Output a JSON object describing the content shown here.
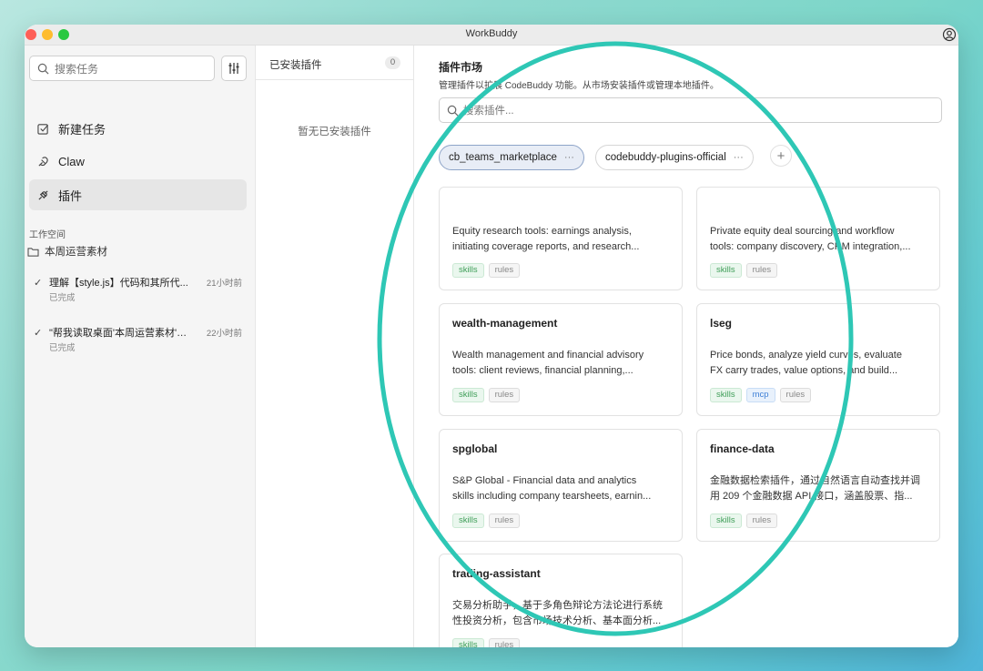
{
  "window": {
    "title": "WorkBuddy"
  },
  "sidebar": {
    "search_placeholder": "搜索任务",
    "items": [
      {
        "label": "新建任务",
        "icon": "edit-icon"
      },
      {
        "label": "Claw",
        "icon": "claw-icon"
      },
      {
        "label": "插件",
        "icon": "plugin-icon",
        "active": true
      }
    ],
    "workspace_label": "工作空间",
    "folder": "本周运营素材",
    "tasks": [
      {
        "title": "理解【style.js】代码和其所代...",
        "time": "21小时前",
        "status": "已完成"
      },
      {
        "title": "\"帮我读取桌面'本周运营素材'文...",
        "time": "22小时前",
        "status": "已完成"
      }
    ]
  },
  "installed": {
    "label": "已安装插件",
    "count": "0",
    "empty": "暂无已安装插件"
  },
  "market": {
    "title": "插件市场",
    "description": "管理插件以扩展 CodeBuddy 功能。从市场安装插件或管理本地插件。",
    "search_placeholder": "搜索插件...",
    "tabs": [
      {
        "label": "cb_teams_marketplace",
        "active": true
      },
      {
        "label": "codebuddy-plugins-official",
        "active": false
      }
    ],
    "more_glyph": "···",
    "add_glyph": "+",
    "cards": [
      {
        "name": "",
        "desc1": "Equity research tools: earnings analysis,",
        "desc2": "initiating coverage reports, and research...",
        "tags": [
          "skills",
          "rules"
        ]
      },
      {
        "name": "",
        "desc1": "Private equity deal sourcing and workflow",
        "desc2": "tools: company discovery, CRM integration,...",
        "tags": [
          "skills",
          "rules"
        ]
      },
      {
        "name": "wealth-management",
        "desc1": "Wealth management and financial advisory",
        "desc2": "tools: client reviews, financial planning,...",
        "tags": [
          "skills",
          "rules"
        ]
      },
      {
        "name": "lseg",
        "desc1": "Price bonds, analyze yield curves, evaluate",
        "desc2": "FX carry trades, value options, and build...",
        "tags": [
          "skills",
          "mcp",
          "rules"
        ]
      },
      {
        "name": "spglobal",
        "desc1": "S&P Global - Financial data and analytics",
        "desc2": "skills including company tearsheets, earnin...",
        "tags": [
          "skills",
          "rules"
        ]
      },
      {
        "name": "finance-data",
        "desc1": "金融数据检索插件，通过自然语言自动查找并调",
        "desc2": "用 209 个金融数据 API 接口，涵盖股票、指...",
        "tags": [
          "skills",
          "rules"
        ]
      },
      {
        "name": "trading-assistant",
        "desc1": "交易分析助手，基于多角色辩论方法论进行系统",
        "desc2": "性投资分析，包含市场技术分析、基本面分析...",
        "tags": [
          "skills",
          "rules"
        ]
      }
    ]
  },
  "annotation": {
    "color": "#2ec7b5"
  }
}
